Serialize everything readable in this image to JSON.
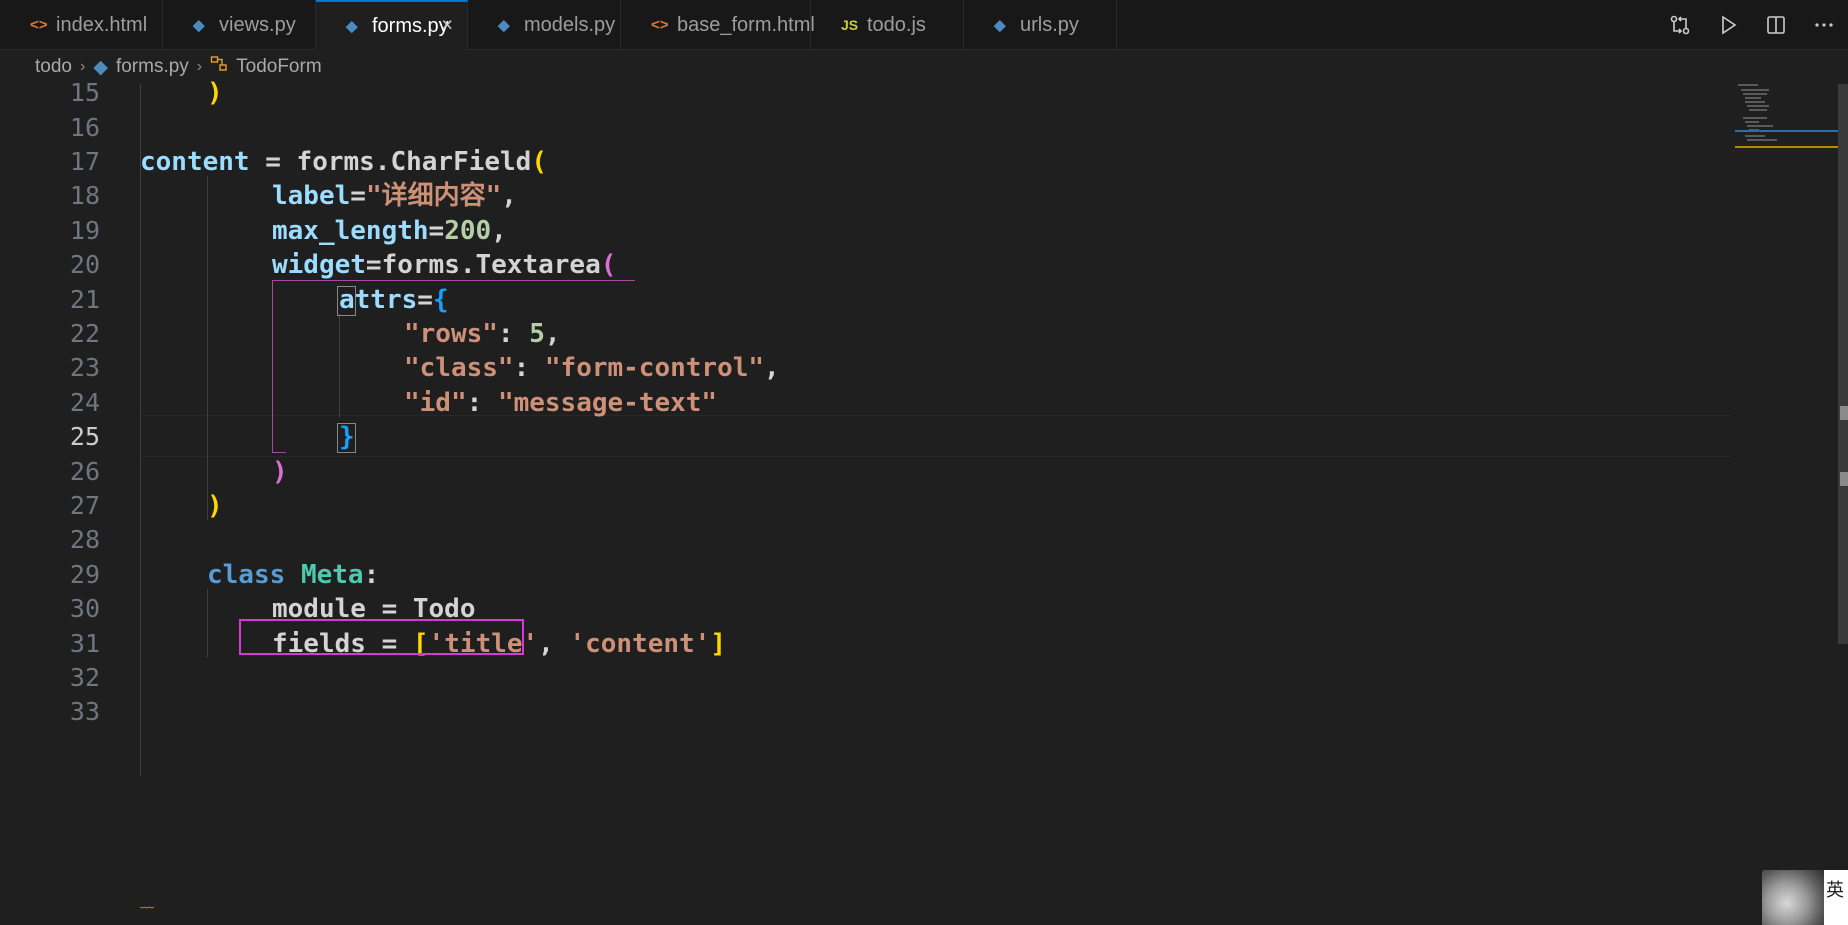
{
  "tabs": [
    {
      "label": "index.html",
      "icon": "html-file-icon",
      "active": false
    },
    {
      "label": "views.py",
      "icon": "python-file-icon",
      "active": false
    },
    {
      "label": "forms.py",
      "icon": "python-file-icon",
      "active": true
    },
    {
      "label": "models.py",
      "icon": "python-file-icon",
      "active": false
    },
    {
      "label": "base_form.html",
      "icon": "html-file-icon",
      "active": false
    },
    {
      "label": "todo.js",
      "icon": "js-file-icon",
      "active": false
    },
    {
      "label": "urls.py",
      "icon": "python-file-icon",
      "active": false
    }
  ],
  "tab_icon_glyphs": {
    "html": "<>",
    "py": "◆",
    "js": "JS",
    "close": "×"
  },
  "toolbar_actions": [
    "source-control-compare-icon",
    "run-icon",
    "split-editor-icon",
    "more-actions-icon"
  ],
  "breadcrumb": {
    "folder": "todo",
    "file": "forms.py",
    "symbol": "TodoForm"
  },
  "line_numbers": [
    "15",
    "16",
    "17",
    "18",
    "19",
    "20",
    "21",
    "22",
    "23",
    "24",
    "25",
    "26",
    "27",
    "28",
    "29",
    "30",
    "31",
    "32",
    "33"
  ],
  "code": {
    "l15": ")",
    "l17_a": "content",
    "l17_b": " = forms.CharField",
    "l17_c": "(",
    "l18_a": "label",
    "l18_b": "=",
    "l18_c": "\"详细内容\"",
    "l18_d": ",",
    "l19_a": "max_length",
    "l19_b": "=",
    "l19_c": "200",
    "l19_d": ",",
    "l20_a": "widget",
    "l20_b": "=forms.Textarea",
    "l20_c": "(",
    "l21_a": "attrs",
    "l21_b": "=",
    "l21_c": "{",
    "l22_a": "\"rows\"",
    "l22_b": ": ",
    "l22_c": "5",
    "l22_d": ",",
    "l23_a": "\"class\"",
    "l23_b": ": ",
    "l23_c": "\"form-control\"",
    "l23_d": ",",
    "l24_a": "\"id\"",
    "l24_b": ": ",
    "l24_c": "\"message-text\"",
    "l25": "}",
    "l26": ")",
    "l27": ")",
    "l29_a": "class",
    "l29_b": " ",
    "l29_c": "Meta",
    "l29_d": ":",
    "l30": "module = Todo",
    "l31_a": "fields = ",
    "l31_b": "[",
    "l31_c": "'title'",
    "l31_d": ", ",
    "l31_e": "'content'",
    "l31_f": "]",
    "squiggle": "﹏"
  },
  "ime_indicator": {
    "text": "英"
  },
  "colors": {
    "accent": "#0078d4",
    "highlight_box": "#d63ad6",
    "editor_bg": "#1f1f1f"
  }
}
